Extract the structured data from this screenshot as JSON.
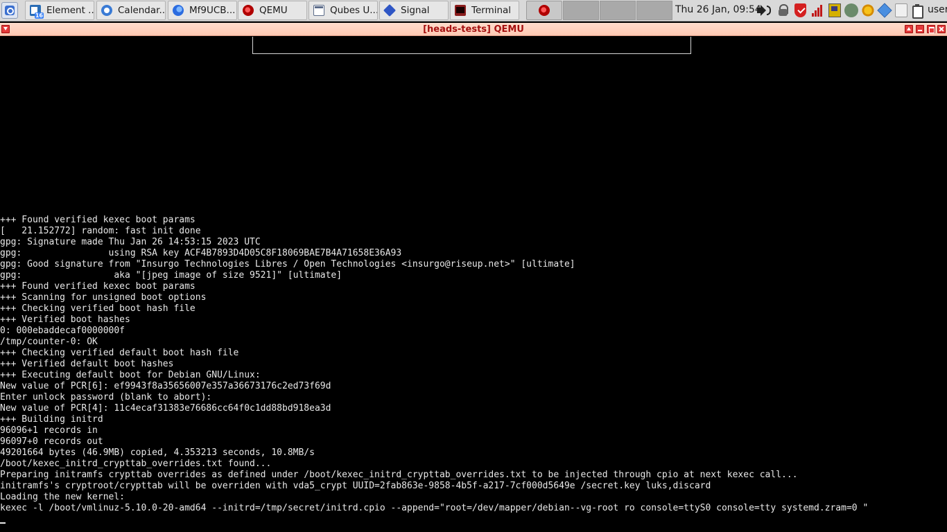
{
  "taskbar": {
    "launcher_icon": "qubes-menu-icon",
    "tasks": [
      {
        "label": "Element ...",
        "icon": "element-icon",
        "badge": "16"
      },
      {
        "label": "Calendar...",
        "icon": "calendar-icon"
      },
      {
        "label": "Mf9UCB...",
        "icon": "firefox-icon"
      },
      {
        "label": "QEMU",
        "icon": "qemu-icon"
      },
      {
        "label": "Qubes U...",
        "icon": "qubes-icon"
      },
      {
        "label": "Signal",
        "icon": "signal-icon"
      },
      {
        "label": "Terminal",
        "icon": "terminal-icon"
      }
    ],
    "clock": "Thu 26 Jan, 09:54",
    "user": "user",
    "tray_icons": [
      "volume-icon",
      "lock-icon",
      "shield-icon",
      "signal-bars-icon",
      "network-icon",
      "settings-icon",
      "weather-icon",
      "qube-cube-icon",
      "document-icon",
      "clipboard-icon"
    ]
  },
  "window": {
    "title": "[heads-tests] QEMU",
    "accent_color": "#a51010"
  },
  "console": {
    "lines": [
      "+++ Found verified kexec boot params",
      "[   21.152772] random: fast init done",
      "gpg: Signature made Thu Jan 26 14:53:15 2023 UTC",
      "gpg:                using RSA key ACF4B7893D4D05C8F18069BAE7B4A71658E36A93",
      "gpg: Good signature from \"Insurgo Technologies Libres / Open Technologies <insurgo@riseup.net>\" [ultimate]",
      "gpg:                 aka \"[jpeg image of size 9521]\" [ultimate]",
      "+++ Found verified kexec boot params",
      "+++ Scanning for unsigned boot options",
      "+++ Checking verified boot hash file",
      "+++ Verified boot hashes",
      "0: 000ebaddecaf0000000f",
      "/tmp/counter-0: OK",
      "+++ Checking verified default boot hash file",
      "+++ Verified default boot hashes",
      "+++ Executing default boot for Debian GNU/Linux:",
      "New value of PCR[6]: ef9943f8a35656007e357a36673176c2ed73f69d",
      "Enter unlock password (blank to abort):",
      "New value of PCR[4]: 11c4ecaf31383e76686cc64f0c1dd88bd918ea3d",
      "+++ Building initrd",
      "96096+1 records in",
      "96097+0 records out",
      "49201664 bytes (46.9MB) copied, 4.353213 seconds, 10.8MB/s",
      "/boot/kexec_initrd_crypttab_overrides.txt found...",
      "Preparing initramfs crypttab overrides as defined under /boot/kexec_initrd_crypttab_overrides.txt to be injected through cpio at next kexec call...",
      "initramfs's cryptroot/crypttab will be overriden with vda5_crypt UUID=2fab863e-9858-4b5f-a217-7cf000d5649e /secret.key luks,discard",
      "Loading the new kernel:",
      "kexec -l /boot/vmlinuz-5.10.0-20-amd64 --initrd=/tmp/secret/initrd.cpio --append=\"root=/dev/mapper/debian--vg-root ro console=ttyS0 console=tty systemd.zram=0 \""
    ]
  }
}
